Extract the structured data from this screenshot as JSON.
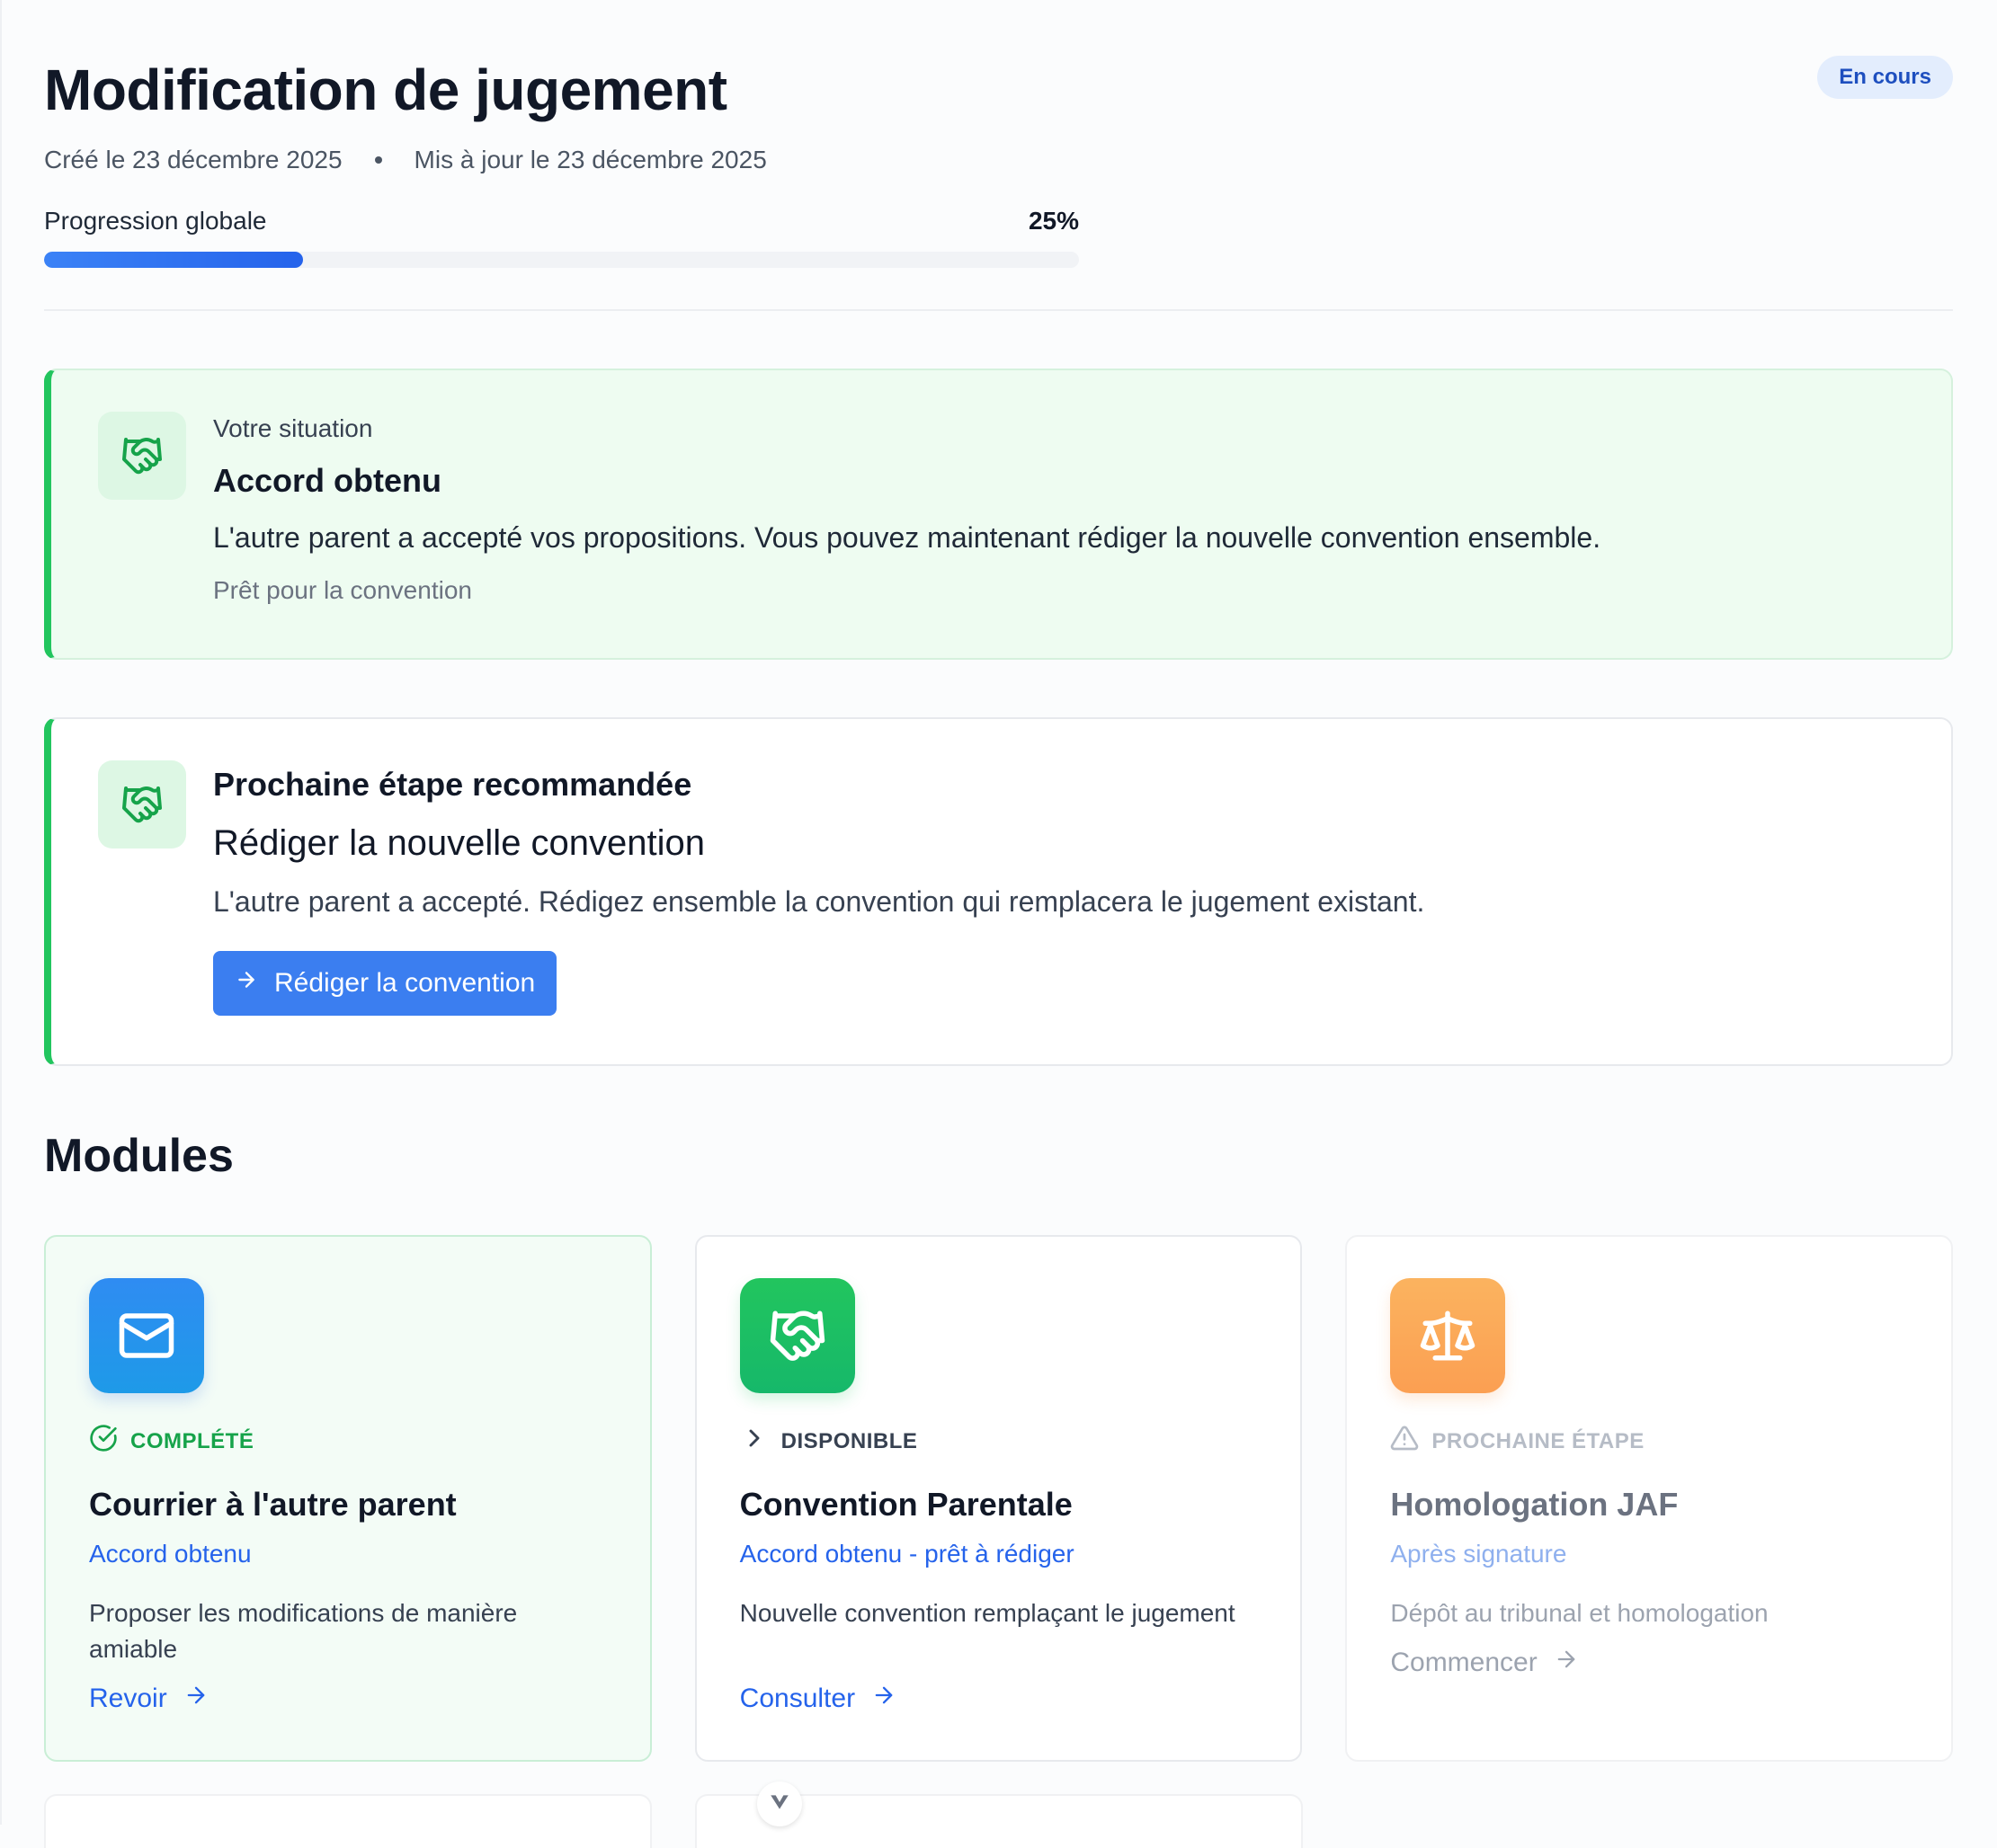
{
  "header": {
    "title": "Modification de jugement",
    "status": "En cours",
    "created": "Créé le 23 décembre 2025",
    "updated": "Mis à jour le 23 décembre 2025",
    "progress_label": "Progression globale",
    "progress_value": "25%",
    "progress_fraction": 0.25
  },
  "situation": {
    "eyebrow": "Votre situation",
    "title": "Accord obtenu",
    "description": "L'autre parent a accepté vos propositions. Vous pouvez maintenant rédiger la nouvelle convention ensemble.",
    "note": "Prêt pour la convention",
    "icon": "handshake-icon"
  },
  "next_step": {
    "label": "Prochaine étape recommandée",
    "title": "Rédiger la nouvelle convention",
    "description": "L'autre parent a accepté. Rédigez ensemble la convention qui remplacera le jugement existant.",
    "button": "Rédiger la convention",
    "icon": "handshake-icon"
  },
  "modules_title": "Modules",
  "modules": [
    {
      "status": "COMPLÉTÉ",
      "title": "Courrier à l'autre parent",
      "subtitle": "Accord obtenu",
      "description": "Proposer les modifications de manière amiable",
      "link": "Revoir",
      "icon": "mail-icon"
    },
    {
      "status": "DISPONIBLE",
      "title": "Convention Parentale",
      "subtitle": "Accord obtenu - prêt à rédiger",
      "description": "Nouvelle convention remplaçant le jugement",
      "link": "Consulter",
      "icon": "handshake-icon"
    },
    {
      "status": "PROCHAINE ÉTAPE",
      "title": "Homologation JAF",
      "subtitle": "Après signature",
      "description": "Dépôt au tribunal et homologation",
      "link": "Commencer",
      "icon": "scale-icon"
    }
  ],
  "colors": {
    "accent": "#3b7ef0",
    "success": "#22c55e",
    "badge_bg": "#e3edfd"
  }
}
